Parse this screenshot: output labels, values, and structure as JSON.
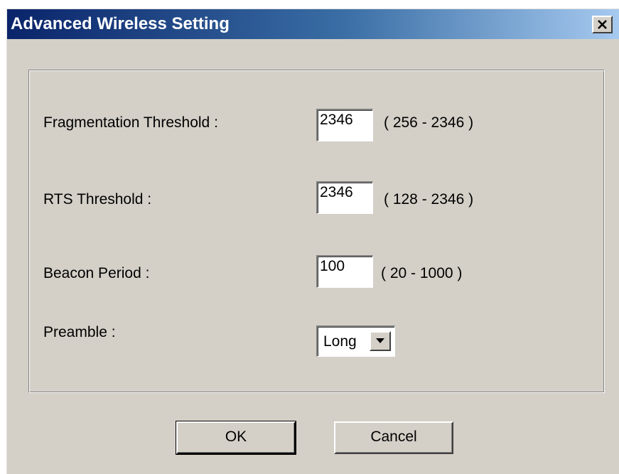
{
  "window": {
    "title": "Advanced Wireless Setting",
    "close_icon": "close-icon"
  },
  "settings": {
    "fragmentation": {
      "label": "Fragmentation Threshold :",
      "value": "2346",
      "range": "( 256 - 2346 )"
    },
    "rts": {
      "label": "RTS Threshold :",
      "value": "2346",
      "range": "( 128 - 2346 )"
    },
    "beacon": {
      "label": "Beacon Period :",
      "value": "100",
      "range": "( 20 - 1000 )"
    },
    "preamble": {
      "label": "Preamble :",
      "selected": "Long",
      "arrow_icon": "chevron-down-icon"
    }
  },
  "buttons": {
    "ok_label": "OK",
    "cancel_label": "Cancel"
  },
  "colors": {
    "titlebar_start": "#0a246a",
    "titlebar_end": "#a6caf0",
    "dialog_face": "#d4d0c8"
  }
}
